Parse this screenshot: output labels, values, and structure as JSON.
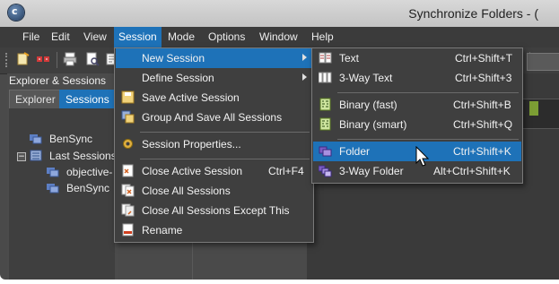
{
  "window": {
    "title": "Synchronize Folders - ("
  },
  "menubar": [
    "File",
    "Edit",
    "View",
    "Session",
    "Mode",
    "Options",
    "Window",
    "Help"
  ],
  "left_pane": {
    "title": "Explorer & Sessions",
    "tabs": [
      "Explorer",
      "Sessions"
    ],
    "tree": [
      {
        "label": "BenSync",
        "icon": "folder-sync-icon"
      },
      {
        "label": "Last Sessions",
        "icon": "last-sessions-icon",
        "expanded": true
      },
      {
        "label": "objective-",
        "icon": "folder-sync-icon"
      },
      {
        "label": "BenSync",
        "icon": "folder-sync-icon"
      }
    ]
  },
  "session_menu": [
    {
      "label": "New Session",
      "icon": "",
      "shortcut": "",
      "submenu": true,
      "highlighted": true
    },
    {
      "label": "Define Session",
      "icon": "",
      "shortcut": "",
      "submenu": true
    },
    {
      "label": "Save Active Session",
      "icon": "save-icon",
      "shortcut": ""
    },
    {
      "label": "Group And Save All Sessions",
      "icon": "group-save-icon",
      "shortcut": ""
    },
    {
      "label": "Session Properties...",
      "icon": "gear-icon",
      "shortcut": ""
    },
    {
      "label": "Close Active Session",
      "icon": "close-session-icon",
      "shortcut": "Ctrl+F4"
    },
    {
      "label": "Close All Sessions",
      "icon": "close-all-icon",
      "shortcut": ""
    },
    {
      "label": "Close All Sessions Except This",
      "icon": "close-except-icon",
      "shortcut": ""
    },
    {
      "label": "Rename",
      "icon": "rename-icon",
      "shortcut": ""
    }
  ],
  "new_session_submenu": [
    {
      "label": "Text",
      "icon": "text-compare-icon",
      "shortcut": "Ctrl+Shift+T"
    },
    {
      "label": "3-Way Text",
      "icon": "three-way-text-icon",
      "shortcut": "Ctrl+Shift+3"
    },
    {
      "label": "Binary (fast)",
      "icon": "binary-fast-icon",
      "shortcut": "Ctrl+Shift+B"
    },
    {
      "label": "Binary (smart)",
      "icon": "binary-smart-icon",
      "shortcut": "Ctrl+Shift+Q"
    },
    {
      "label": "Folder",
      "icon": "folder-compare-icon",
      "shortcut": "Ctrl+Shift+K",
      "highlighted": true
    },
    {
      "label": "3-Way Folder",
      "icon": "three-way-folder-icon",
      "shortcut": "Alt+Ctrl+Shift+K"
    }
  ],
  "colors": {
    "accent": "#1e72b8",
    "menu_bg": "#3f3f3f",
    "app_bg": "#4a4a4a"
  }
}
